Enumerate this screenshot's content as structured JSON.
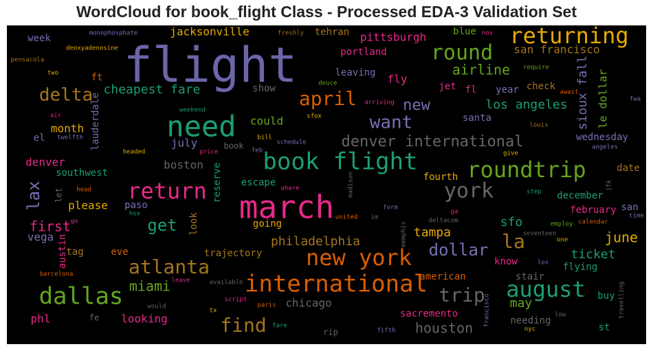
{
  "title": "WordCloud for book_flight Class - Processed EDA-3 Validation Set",
  "background_color": "#000000",
  "words": [
    {
      "text": "flight",
      "color": "#6b66a8"
    },
    {
      "text": "march",
      "color": "#e7298a"
    },
    {
      "text": "book flight",
      "color": "#1b9e77"
    },
    {
      "text": "need",
      "color": "#1b9e77"
    },
    {
      "text": "international",
      "color": "#d95f02"
    },
    {
      "text": "new york",
      "color": "#d95f02"
    },
    {
      "text": "roundtrip",
      "color": "#66a61e"
    },
    {
      "text": "returning",
      "color": "#e6ab02"
    },
    {
      "text": "return",
      "color": "#e7298a"
    },
    {
      "text": "dallas",
      "color": "#66a61e"
    },
    {
      "text": "august",
      "color": "#1b9e77"
    },
    {
      "text": "round",
      "color": "#66a61e"
    },
    {
      "text": "atlanta",
      "color": "#a6761d"
    },
    {
      "text": "york",
      "color": "#666666"
    },
    {
      "text": "april",
      "color": "#d95f02"
    },
    {
      "text": "find",
      "color": "#a6761d"
    },
    {
      "text": "trip",
      "color": "#666666"
    },
    {
      "text": "delta",
      "color": "#a6761d"
    },
    {
      "text": "want",
      "color": "#7570b3"
    },
    {
      "text": "denver international",
      "color": "#666666"
    },
    {
      "text": "la",
      "color": "#a6761d"
    },
    {
      "text": "dollar",
      "color": "#7570b3"
    },
    {
      "text": "lax",
      "color": "#7570b3"
    },
    {
      "text": "get",
      "color": "#1b9e77"
    },
    {
      "text": "new",
      "color": "#7570b3"
    },
    {
      "text": "miami",
      "color": "#66a61e"
    },
    {
      "text": "houston",
      "color": "#666666"
    },
    {
      "text": "airline",
      "color": "#66a61e"
    },
    {
      "text": "philadelphia",
      "color": "#a6761d"
    },
    {
      "text": "los angeles",
      "color": "#1b9e77"
    },
    {
      "text": "june",
      "color": "#e6ab02"
    },
    {
      "text": "first",
      "color": "#e7298a"
    },
    {
      "text": "cheapest fare",
      "color": "#1b9e77"
    },
    {
      "text": "san francisco",
      "color": "#a6761d"
    },
    {
      "text": "sioux fall",
      "color": "#7570b3"
    },
    {
      "text": "le dollar",
      "color": "#66a61e"
    },
    {
      "text": "jacksonville",
      "color": "#e6ab02"
    },
    {
      "text": "pittsburgh",
      "color": "#e7298a"
    },
    {
      "text": "tampa",
      "color": "#e6ab02"
    },
    {
      "text": "chicago",
      "color": "#666666"
    },
    {
      "text": "may",
      "color": "#66a61e"
    },
    {
      "text": "ticket",
      "color": "#1b9e77"
    },
    {
      "text": "sfo",
      "color": "#1b9e77"
    },
    {
      "text": "denver",
      "color": "#e7298a"
    },
    {
      "text": "boston",
      "color": "#666666"
    },
    {
      "text": "sacremento",
      "color": "#e7298a"
    },
    {
      "text": "looking",
      "color": "#e7298a"
    },
    {
      "text": "portland",
      "color": "#e7298a"
    },
    {
      "text": "tehran",
      "color": "#a6761d"
    },
    {
      "text": "fly",
      "color": "#e7298a"
    },
    {
      "text": "could",
      "color": "#66a61e"
    },
    {
      "text": "july",
      "color": "#7570b3"
    },
    {
      "text": "month",
      "color": "#e6ab02"
    },
    {
      "text": "please",
      "color": "#e6ab02"
    },
    {
      "text": "phl",
      "color": "#e7298a"
    },
    {
      "text": "vega",
      "color": "#7570b3"
    },
    {
      "text": "southwest",
      "color": "#1b9e77"
    },
    {
      "text": "show",
      "color": "#666666"
    },
    {
      "text": "leaving",
      "color": "#7570b3"
    },
    {
      "text": "santa",
      "color": "#7570b3"
    },
    {
      "text": "fourth",
      "color": "#e6ab02"
    },
    {
      "text": "wednesday",
      "color": "#7570b3"
    },
    {
      "text": "december",
      "color": "#1b9e77"
    },
    {
      "text": "february",
      "color": "#e7298a"
    },
    {
      "text": "san",
      "color": "#7570b3"
    },
    {
      "text": "date",
      "color": "#a6761d"
    },
    {
      "text": "going",
      "color": "#e6ab02"
    },
    {
      "text": "escape",
      "color": "#1b9e77"
    },
    {
      "text": "look",
      "color": "#a6761d"
    },
    {
      "text": "trajectory",
      "color": "#a6761d"
    },
    {
      "text": "american",
      "color": "#d95f02"
    },
    {
      "text": "stair",
      "color": "#666666"
    },
    {
      "text": "flying",
      "color": "#1b9e77"
    },
    {
      "text": "needing",
      "color": "#666666"
    },
    {
      "text": "buy",
      "color": "#1b9e77"
    },
    {
      "text": "st",
      "color": "#1b9e77"
    },
    {
      "text": "know",
      "color": "#e7298a"
    },
    {
      "text": "year",
      "color": "#7570b3"
    },
    {
      "text": "check",
      "color": "#a6761d"
    },
    {
      "text": "jet",
      "color": "#e7298a"
    },
    {
      "text": "fl",
      "color": "#e7298a"
    },
    {
      "text": "blue",
      "color": "#66a61e"
    },
    {
      "text": "week",
      "color": "#7570b3"
    },
    {
      "text": "ft",
      "color": "#d95f02"
    },
    {
      "text": "el",
      "color": "#7570b3"
    },
    {
      "text": "lauderdale",
      "color": "#7570b3"
    },
    {
      "text": "austin",
      "color": "#e7298a"
    },
    {
      "text": "tag",
      "color": "#a6761d"
    },
    {
      "text": "eve",
      "color": "#d95f02"
    },
    {
      "text": "paso",
      "color": "#7570b3"
    },
    {
      "text": "reserve",
      "color": "#1b9e77"
    },
    {
      "text": "let",
      "color": "#666666"
    },
    {
      "text": "book",
      "color": "#666666"
    },
    {
      "text": "fe",
      "color": "#666666"
    },
    {
      "text": "rip",
      "color": "#666666"
    },
    {
      "text": "monophosphate",
      "color": "#7570b3"
    },
    {
      "text": "deoxyadenosine",
      "color": "#e6ab02"
    },
    {
      "text": "pensacola",
      "color": "#a6761d"
    },
    {
      "text": "freshly",
      "color": "#a6761d"
    },
    {
      "text": "nov",
      "color": "#e7298a"
    },
    {
      "text": "two",
      "color": "#e6ab02"
    },
    {
      "text": "deuce",
      "color": "#66a61e"
    },
    {
      "text": "arriving",
      "color": "#e7298a"
    },
    {
      "text": "sfox",
      "color": "#e6ab02"
    },
    {
      "text": "require",
      "color": "#66a61e"
    },
    {
      "text": "await",
      "color": "#d95f02"
    },
    {
      "text": "fwa",
      "color": "#7570b3"
    },
    {
      "text": "weekend",
      "color": "#1b9e77"
    },
    {
      "text": "air",
      "color": "#e7298a"
    },
    {
      "text": "twelfth",
      "color": "#7570b3"
    },
    {
      "text": "louis",
      "color": "#a6761d"
    },
    {
      "text": "give",
      "color": "#e6ab02"
    },
    {
      "text": "angeles",
      "color": "#7570b3"
    },
    {
      "text": "bill",
      "color": "#e6ab02"
    },
    {
      "text": "schedule",
      "color": "#7570b3"
    },
    {
      "text": "feb",
      "color": "#7570b3"
    },
    {
      "text": "headed",
      "color": "#e6ab02"
    },
    {
      "text": "price",
      "color": "#e7298a"
    },
    {
      "text": "head",
      "color": "#d95f02"
    },
    {
      "text": "ohare",
      "color": "#e7298a"
    },
    {
      "text": "madison",
      "color": "#666666"
    },
    {
      "text": "step",
      "color": "#1b9e77"
    },
    {
      "text": "jfk",
      "color": "#666666"
    },
    {
      "text": "time",
      "color": "#7570b3"
    },
    {
      "text": "go",
      "color": "#e7298a"
    },
    {
      "text": "hsv",
      "color": "#1b9e77"
    },
    {
      "text": "form",
      "color": "#7570b3"
    },
    {
      "text": "ga",
      "color": "#e7298a"
    },
    {
      "text": "united",
      "color": "#d95f02"
    },
    {
      "text": "im",
      "color": "#666666"
    },
    {
      "text": "deltacom",
      "color": "#666666"
    },
    {
      "text": "employ",
      "color": "#66a61e"
    },
    {
      "text": "calendar",
      "color": "#d95f02"
    },
    {
      "text": "seventeen",
      "color": "#666666"
    },
    {
      "text": "one",
      "color": "#e6ab02"
    },
    {
      "text": "memphis",
      "color": "#666666"
    },
    {
      "text": "barcelona",
      "color": "#d95f02"
    },
    {
      "text": "los",
      "color": "#7570b3"
    },
    {
      "text": "leave",
      "color": "#e7298a"
    },
    {
      "text": "available",
      "color": "#666666"
    },
    {
      "text": "would",
      "color": "#666666"
    },
    {
      "text": "script",
      "color": "#e7298a"
    },
    {
      "text": "paris",
      "color": "#d95f02"
    },
    {
      "text": "tx",
      "color": "#e6ab02"
    },
    {
      "text": "francisco",
      "color": "#7570b3"
    },
    {
      "text": "travelling",
      "color": "#666666"
    },
    {
      "text": "low",
      "color": "#666666"
    },
    {
      "text": "nyc",
      "color": "#e6ab02"
    },
    {
      "text": "fare",
      "color": "#1b9e77"
    },
    {
      "text": "fifth",
      "color": "#7570b3"
    }
  ]
}
